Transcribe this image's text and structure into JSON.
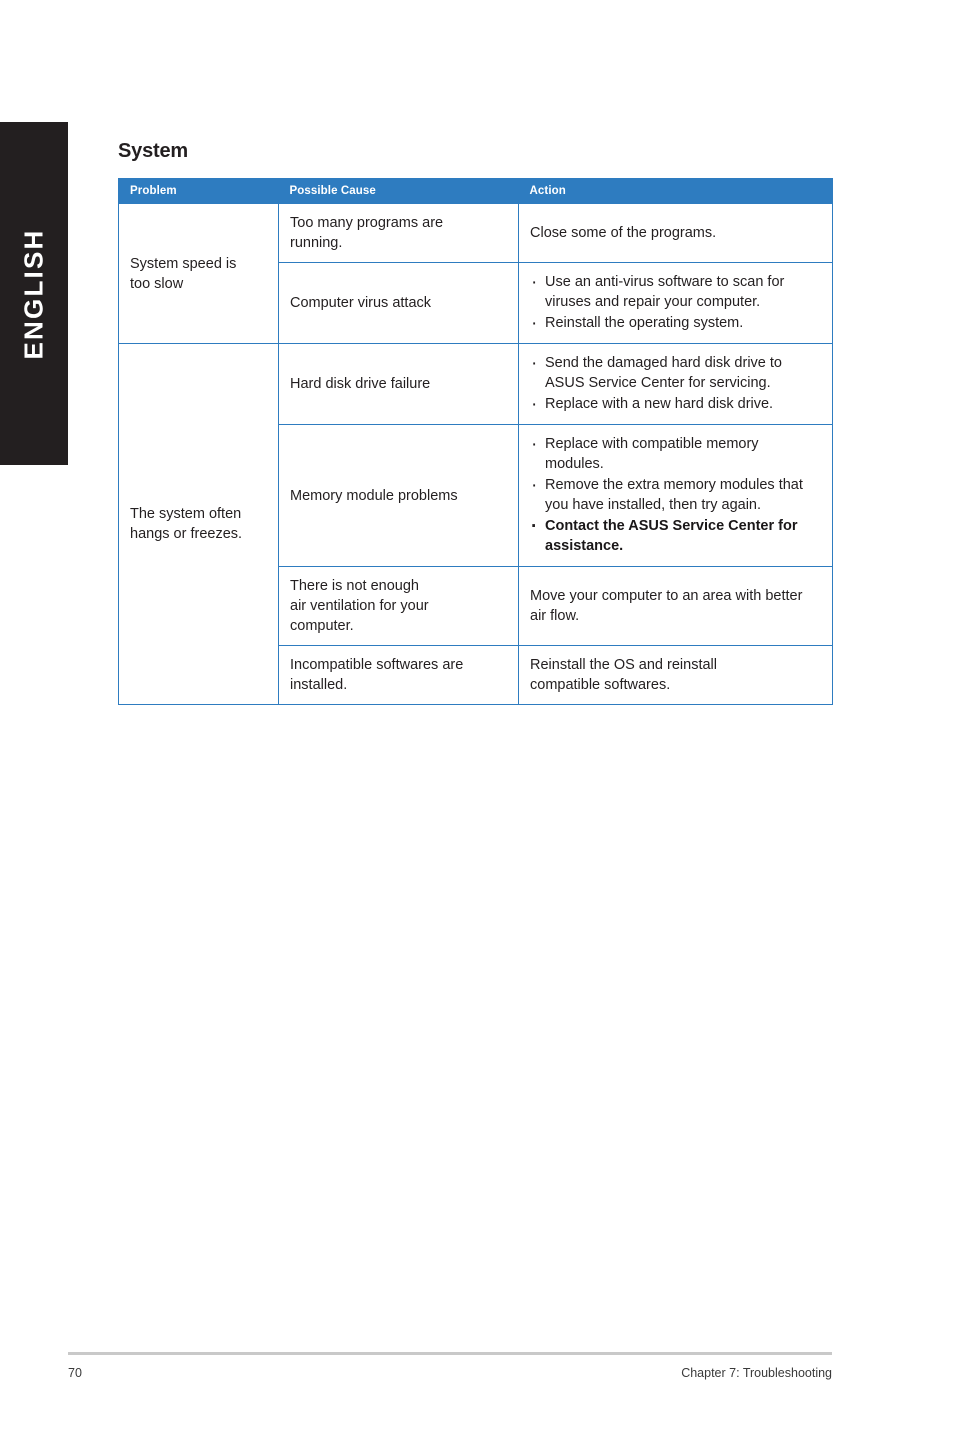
{
  "language_tab": {
    "label": "ENGLISH"
  },
  "page": {
    "title": "System"
  },
  "colors": {
    "header_blue": "#2e7cc0",
    "border_blue": "#2e7cc0",
    "tab_black": "#231f20",
    "text": "#231f20",
    "footer_rule": "#c9c9c9"
  },
  "table": {
    "columns": [
      "Problem",
      "Possible Cause",
      "Action"
    ],
    "rows": [
      {
        "problem": "System speed is\ntoo slow",
        "problem_rowspan": 2,
        "cause": "Too many programs are\nrunning.",
        "action_text": "Close some of the programs.",
        "action_bullets": []
      },
      {
        "problem": null,
        "cause": "Computer virus attack",
        "action_text": null,
        "action_bullets": [
          {
            "text": "Use an anti-virus software to scan for viruses and repair your computer.",
            "emphasis": false
          },
          {
            "text": "Reinstall the operating system.",
            "emphasis": false
          }
        ]
      },
      {
        "problem": "The system often\nhangs or freezes.",
        "problem_rowspan": 4,
        "cause": "Hard disk drive failure",
        "action_text": null,
        "action_bullets": [
          {
            "text": "Send the damaged hard disk drive to ASUS Service Center for servicing.",
            "emphasis": false
          },
          {
            "text": "Replace with a new hard disk drive.",
            "emphasis": false
          }
        ]
      },
      {
        "problem": null,
        "cause": "Memory module problems",
        "action_text": null,
        "action_bullets": [
          {
            "text": "Replace with compatible memory modules.",
            "emphasis": false
          },
          {
            "text": "Remove the extra memory modules that you have installed, then try again.",
            "emphasis": false
          },
          {
            "text": "Contact the ASUS Service Center for assistance.",
            "emphasis": true
          }
        ]
      },
      {
        "problem": null,
        "cause": "There is not enough\nair ventilation for your\ncomputer.",
        "action_text": "Move your computer to an area with better air flow.",
        "action_bullets": []
      },
      {
        "problem": null,
        "cause": "Incompatible softwares are\ninstalled.",
        "action_text": "Reinstall the OS and reinstall\ncompatible softwares.",
        "action_bullets": []
      }
    ]
  },
  "footer": {
    "page_number": "70",
    "chapter": "Chapter 7: Troubleshooting"
  }
}
